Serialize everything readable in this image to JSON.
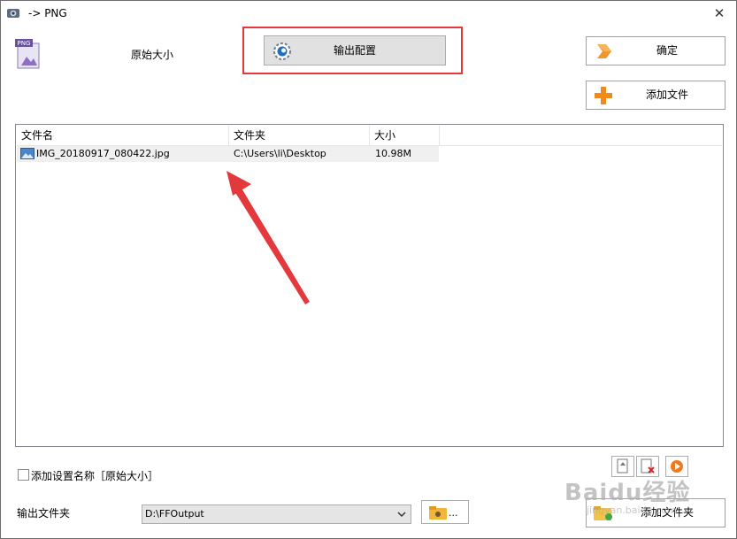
{
  "window": {
    "title": "-> PNG",
    "close_glyph": "✕"
  },
  "header": {
    "format_icon_text": "PNG",
    "profile_label": "原始大小"
  },
  "toolbar": {
    "output_settings_label": "输出配置",
    "ok_label": "确定",
    "add_file_label": "添加文件"
  },
  "file_list": {
    "columns": [
      "文件名",
      "文件夹",
      "大小"
    ],
    "rows": [
      {
        "name": "IMG_20180917_080422.jpg",
        "folder": "C:\\Users\\li\\Desktop",
        "size": "10.98M"
      }
    ]
  },
  "options": {
    "add_setting_name_label": "添加设置名称［原始大小］",
    "add_setting_name_checked": false
  },
  "output": {
    "folder_label": "输出文件夹",
    "folder_value": "D:\\FFOutput",
    "browse_dots": "...",
    "add_folder_label": "添加文件夹"
  },
  "watermark": {
    "text": "Baidu经验",
    "sub": "jingyan.baidu.com"
  },
  "colors": {
    "highlight": "#e4393c",
    "arrow": "#e4393c",
    "button_bg": "#e1e1e1"
  }
}
